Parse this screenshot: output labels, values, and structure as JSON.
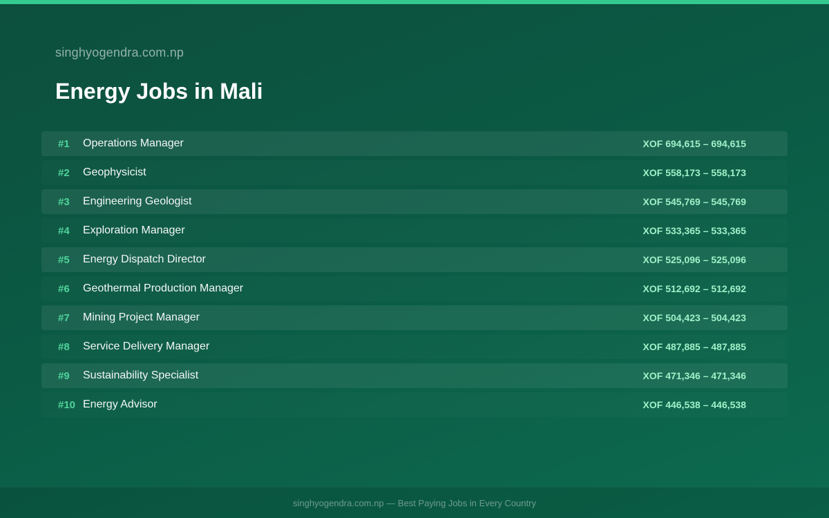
{
  "header": {
    "site_name": "singhyogendra.com.np",
    "title": "Energy Jobs in Mali"
  },
  "jobs": [
    {
      "rank": "#1",
      "title": "Operations Manager",
      "salary": "XOF 694,615 – 694,615"
    },
    {
      "rank": "#2",
      "title": "Geophysicist",
      "salary": "XOF 558,173 – 558,173"
    },
    {
      "rank": "#3",
      "title": "Engineering Geologist",
      "salary": "XOF 545,769 – 545,769"
    },
    {
      "rank": "#4",
      "title": "Exploration Manager",
      "salary": "XOF 533,365 – 533,365"
    },
    {
      "rank": "#5",
      "title": "Energy Dispatch Director",
      "salary": "XOF 525,096 – 525,096"
    },
    {
      "rank": "#6",
      "title": "Geothermal Production Manager",
      "salary": "XOF 512,692 – 512,692"
    },
    {
      "rank": "#7",
      "title": "Mining Project Manager",
      "salary": "XOF 504,423 – 504,423"
    },
    {
      "rank": "#8",
      "title": "Service Delivery Manager",
      "salary": "XOF 487,885 – 487,885"
    },
    {
      "rank": "#9",
      "title": "Sustainability Specialist",
      "salary": "XOF 471,346 – 471,346"
    },
    {
      "rank": "#10",
      "title": "Energy Advisor",
      "salary": "XOF 446,538 – 446,538"
    }
  ],
  "footer": {
    "text": "singhyogendra.com.np — Best Paying Jobs in Every Country"
  },
  "colors": {
    "accent": "#34c98e",
    "rank": "#4fd39b",
    "salary": "#9ff0c8",
    "background": "#0b5a44"
  }
}
